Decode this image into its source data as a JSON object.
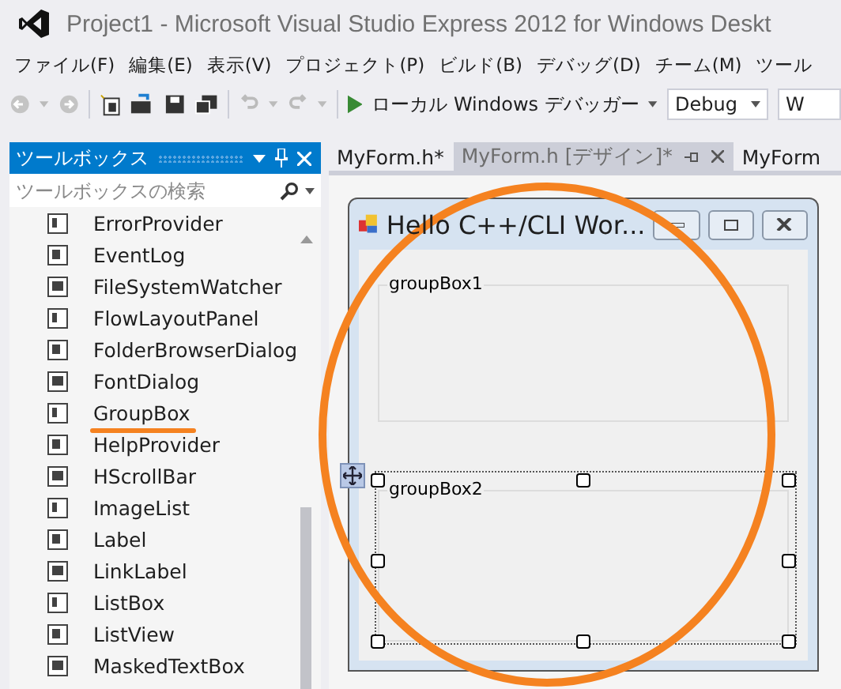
{
  "window": {
    "title": "Project1 - Microsoft Visual Studio Express 2012 for Windows Deskt"
  },
  "menu": [
    "ファイル(F)",
    "編集(E)",
    "表示(V)",
    "プロジェクト(P)",
    "ビルド(B)",
    "デバッグ(D)",
    "チーム(M)",
    "ツール"
  ],
  "toolbar": {
    "debugger": "ローカル Windows デバッガー",
    "configuration": "Debug",
    "platform": "W"
  },
  "toolbox": {
    "title": "ツールボックス",
    "search": {
      "placeholder": "ツールボックスの検索"
    },
    "items": [
      {
        "label": "ErrorProvider",
        "highlighted": false
      },
      {
        "label": "EventLog",
        "highlighted": false
      },
      {
        "label": "FileSystemWatcher",
        "highlighted": false
      },
      {
        "label": "FlowLayoutPanel",
        "highlighted": false
      },
      {
        "label": "FolderBrowserDialog",
        "highlighted": false
      },
      {
        "label": "FontDialog",
        "highlighted": false
      },
      {
        "label": "GroupBox",
        "highlighted": true
      },
      {
        "label": "HelpProvider",
        "highlighted": false
      },
      {
        "label": "HScrollBar",
        "highlighted": false
      },
      {
        "label": "ImageList",
        "highlighted": false
      },
      {
        "label": "Label",
        "highlighted": false
      },
      {
        "label": "LinkLabel",
        "highlighted": false
      },
      {
        "label": "ListBox",
        "highlighted": false
      },
      {
        "label": "ListView",
        "highlighted": false
      },
      {
        "label": "MaskedTextBox",
        "highlighted": false
      }
    ]
  },
  "tabs": [
    {
      "label": "MyForm.h*",
      "selected": false
    },
    {
      "label": "MyForm.h [デザイン]*",
      "selected": true
    },
    {
      "label": "MyForm",
      "selected": false
    }
  ],
  "designer": {
    "form": {
      "title": "Hello C++/CLI Wor...",
      "group_boxes": [
        {
          "label": "groupBox1",
          "selected": false
        },
        {
          "label": "groupBox2",
          "selected": true
        }
      ]
    }
  }
}
